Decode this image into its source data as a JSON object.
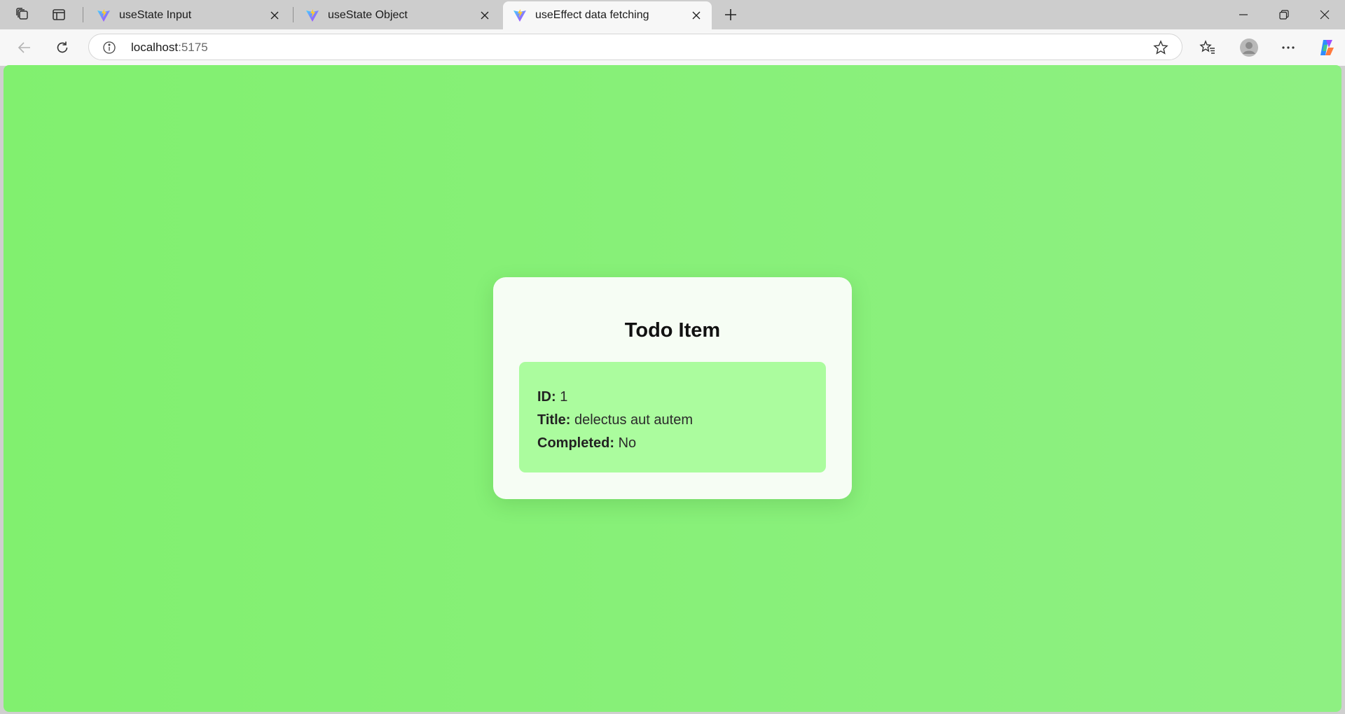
{
  "browser": {
    "tabs": [
      {
        "title": "useState Input",
        "active": false
      },
      {
        "title": "useState Object",
        "active": false
      },
      {
        "title": "useEffect data fetching",
        "active": true
      }
    ],
    "url": {
      "host": "localhost",
      "port": ":5175"
    }
  },
  "page": {
    "heading": "Todo Item",
    "fields": [
      {
        "label": "ID:",
        "value": "1"
      },
      {
        "label": "Title:",
        "value": "delectus aut autem"
      },
      {
        "label": "Completed:",
        "value": "No"
      }
    ]
  },
  "colors": {
    "page_background": "#86f076",
    "card_background": "#f6fdf4",
    "detail_background": "#abfc9e"
  },
  "icons": [
    "workspaces-icon",
    "vertical-tabs-icon",
    "vite-icon",
    "close-icon",
    "plus-icon",
    "minimize-icon",
    "restore-icon",
    "back-icon",
    "refresh-icon",
    "info-icon",
    "star-icon",
    "favorites-icon",
    "profile-icon",
    "more-icon",
    "copilot-icon"
  ]
}
